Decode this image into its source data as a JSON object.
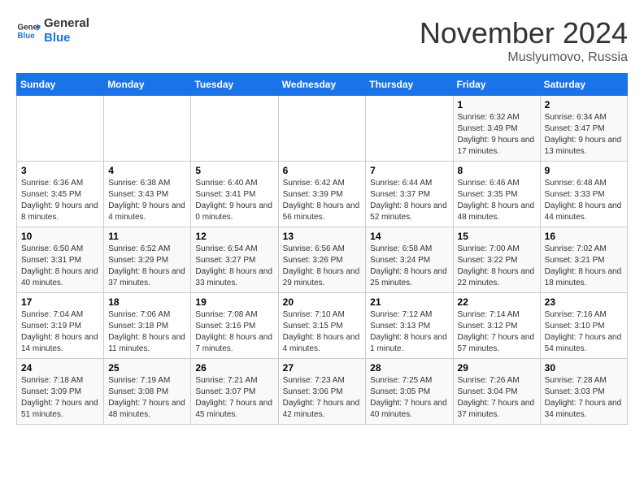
{
  "logo": {
    "line1": "General",
    "line2": "Blue"
  },
  "title": "November 2024",
  "location": "Muslyumovo, Russia",
  "days_of_week": [
    "Sunday",
    "Monday",
    "Tuesday",
    "Wednesday",
    "Thursday",
    "Friday",
    "Saturday"
  ],
  "weeks": [
    [
      {
        "day": "",
        "info": ""
      },
      {
        "day": "",
        "info": ""
      },
      {
        "day": "",
        "info": ""
      },
      {
        "day": "",
        "info": ""
      },
      {
        "day": "",
        "info": ""
      },
      {
        "day": "1",
        "info": "Sunrise: 6:32 AM\nSunset: 3:49 PM\nDaylight: 9 hours and 17 minutes."
      },
      {
        "day": "2",
        "info": "Sunrise: 6:34 AM\nSunset: 3:47 PM\nDaylight: 9 hours and 13 minutes."
      }
    ],
    [
      {
        "day": "3",
        "info": "Sunrise: 6:36 AM\nSunset: 3:45 PM\nDaylight: 9 hours and 8 minutes."
      },
      {
        "day": "4",
        "info": "Sunrise: 6:38 AM\nSunset: 3:43 PM\nDaylight: 9 hours and 4 minutes."
      },
      {
        "day": "5",
        "info": "Sunrise: 6:40 AM\nSunset: 3:41 PM\nDaylight: 9 hours and 0 minutes."
      },
      {
        "day": "6",
        "info": "Sunrise: 6:42 AM\nSunset: 3:39 PM\nDaylight: 8 hours and 56 minutes."
      },
      {
        "day": "7",
        "info": "Sunrise: 6:44 AM\nSunset: 3:37 PM\nDaylight: 8 hours and 52 minutes."
      },
      {
        "day": "8",
        "info": "Sunrise: 6:46 AM\nSunset: 3:35 PM\nDaylight: 8 hours and 48 minutes."
      },
      {
        "day": "9",
        "info": "Sunrise: 6:48 AM\nSunset: 3:33 PM\nDaylight: 8 hours and 44 minutes."
      }
    ],
    [
      {
        "day": "10",
        "info": "Sunrise: 6:50 AM\nSunset: 3:31 PM\nDaylight: 8 hours and 40 minutes."
      },
      {
        "day": "11",
        "info": "Sunrise: 6:52 AM\nSunset: 3:29 PM\nDaylight: 8 hours and 37 minutes."
      },
      {
        "day": "12",
        "info": "Sunrise: 6:54 AM\nSunset: 3:27 PM\nDaylight: 8 hours and 33 minutes."
      },
      {
        "day": "13",
        "info": "Sunrise: 6:56 AM\nSunset: 3:26 PM\nDaylight: 8 hours and 29 minutes."
      },
      {
        "day": "14",
        "info": "Sunrise: 6:58 AM\nSunset: 3:24 PM\nDaylight: 8 hours and 25 minutes."
      },
      {
        "day": "15",
        "info": "Sunrise: 7:00 AM\nSunset: 3:22 PM\nDaylight: 8 hours and 22 minutes."
      },
      {
        "day": "16",
        "info": "Sunrise: 7:02 AM\nSunset: 3:21 PM\nDaylight: 8 hours and 18 minutes."
      }
    ],
    [
      {
        "day": "17",
        "info": "Sunrise: 7:04 AM\nSunset: 3:19 PM\nDaylight: 8 hours and 14 minutes."
      },
      {
        "day": "18",
        "info": "Sunrise: 7:06 AM\nSunset: 3:18 PM\nDaylight: 8 hours and 11 minutes."
      },
      {
        "day": "19",
        "info": "Sunrise: 7:08 AM\nSunset: 3:16 PM\nDaylight: 8 hours and 7 minutes."
      },
      {
        "day": "20",
        "info": "Sunrise: 7:10 AM\nSunset: 3:15 PM\nDaylight: 8 hours and 4 minutes."
      },
      {
        "day": "21",
        "info": "Sunrise: 7:12 AM\nSunset: 3:13 PM\nDaylight: 8 hours and 1 minute."
      },
      {
        "day": "22",
        "info": "Sunrise: 7:14 AM\nSunset: 3:12 PM\nDaylight: 7 hours and 57 minutes."
      },
      {
        "day": "23",
        "info": "Sunrise: 7:16 AM\nSunset: 3:10 PM\nDaylight: 7 hours and 54 minutes."
      }
    ],
    [
      {
        "day": "24",
        "info": "Sunrise: 7:18 AM\nSunset: 3:09 PM\nDaylight: 7 hours and 51 minutes."
      },
      {
        "day": "25",
        "info": "Sunrise: 7:19 AM\nSunset: 3:08 PM\nDaylight: 7 hours and 48 minutes."
      },
      {
        "day": "26",
        "info": "Sunrise: 7:21 AM\nSunset: 3:07 PM\nDaylight: 7 hours and 45 minutes."
      },
      {
        "day": "27",
        "info": "Sunrise: 7:23 AM\nSunset: 3:06 PM\nDaylight: 7 hours and 42 minutes."
      },
      {
        "day": "28",
        "info": "Sunrise: 7:25 AM\nSunset: 3:05 PM\nDaylight: 7 hours and 40 minutes."
      },
      {
        "day": "29",
        "info": "Sunrise: 7:26 AM\nSunset: 3:04 PM\nDaylight: 7 hours and 37 minutes."
      },
      {
        "day": "30",
        "info": "Sunrise: 7:28 AM\nSunset: 3:03 PM\nDaylight: 7 hours and 34 minutes."
      }
    ]
  ]
}
